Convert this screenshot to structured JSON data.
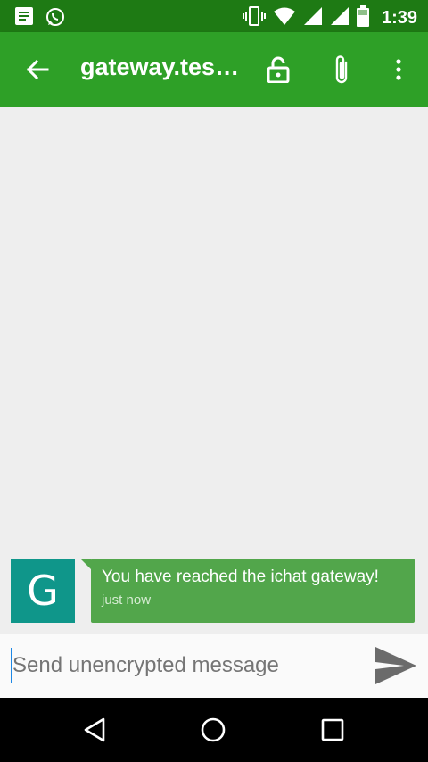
{
  "status_bar": {
    "time": "1:39",
    "left_icons": [
      "notes-icon",
      "whatsapp-icon"
    ],
    "right_icons": [
      "vibrate-icon",
      "wifi-icon",
      "signal-icon",
      "signal-icon",
      "battery-icon"
    ]
  },
  "toolbar": {
    "title": "gateway.tes…",
    "icons": [
      "back-arrow-icon",
      "unlock-icon",
      "attachment-icon",
      "more-vert-icon"
    ]
  },
  "messages": [
    {
      "avatar_letter": "G",
      "text": "You have reached the ichat gateway!",
      "time": "just now"
    }
  ],
  "compose": {
    "placeholder": "Send unencrypted message",
    "value": ""
  },
  "nav_bar": {
    "icons": [
      "back-triangle-icon",
      "home-circle-icon",
      "recents-square-icon"
    ]
  },
  "colors": {
    "status_bar": "#1e7a14",
    "toolbar": "#2ea027",
    "bubble": "#52a64b",
    "avatar": "#0f968a"
  }
}
